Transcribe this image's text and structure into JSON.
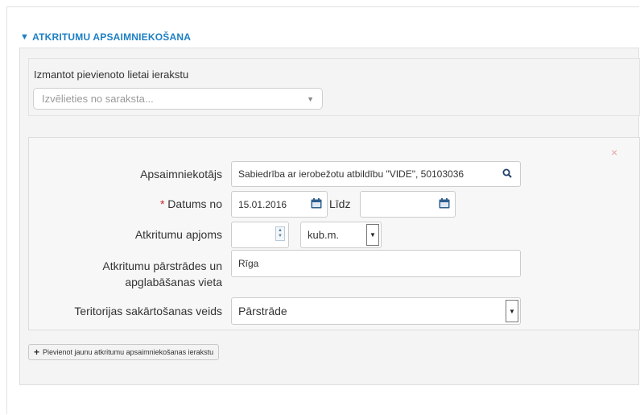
{
  "section": {
    "title": "ATKRITUMU APSAIMNIEKOŠANA",
    "toggle_icon": "triangle-down-icon"
  },
  "record_select": {
    "label": "Izmantot pievienoto lietai ierakstu",
    "placeholder": "Izvēlieties no saraksta..."
  },
  "form": {
    "close_symbol": "×",
    "manager": {
      "label": "Apsaimniekotājs",
      "value": "Sabiedrība ar ierobežotu atbildību \"VIDE\", 50103036"
    },
    "date_from": {
      "required_mark": "*",
      "label": "Datums no",
      "value": "15.01.2016"
    },
    "date_to": {
      "label": "Līdz",
      "value": ""
    },
    "volume": {
      "label": "Atkritumu apjoms",
      "value": "",
      "unit": "kub.m."
    },
    "place": {
      "label_line1": "Atkritumu pārstrādes un",
      "label_line2": "apglabāšanas vieta",
      "value": "Rīga"
    },
    "method": {
      "label": "Teritorijas sakārtošanas veids",
      "value": "Pārstrāde"
    }
  },
  "add_button": {
    "label": "Pievienot jaunu atkritumu apsaimniekošanas ierakstu"
  },
  "colors": {
    "accent": "#1e7fc4",
    "required": "#cc2222",
    "close": "#e6a3a3"
  }
}
